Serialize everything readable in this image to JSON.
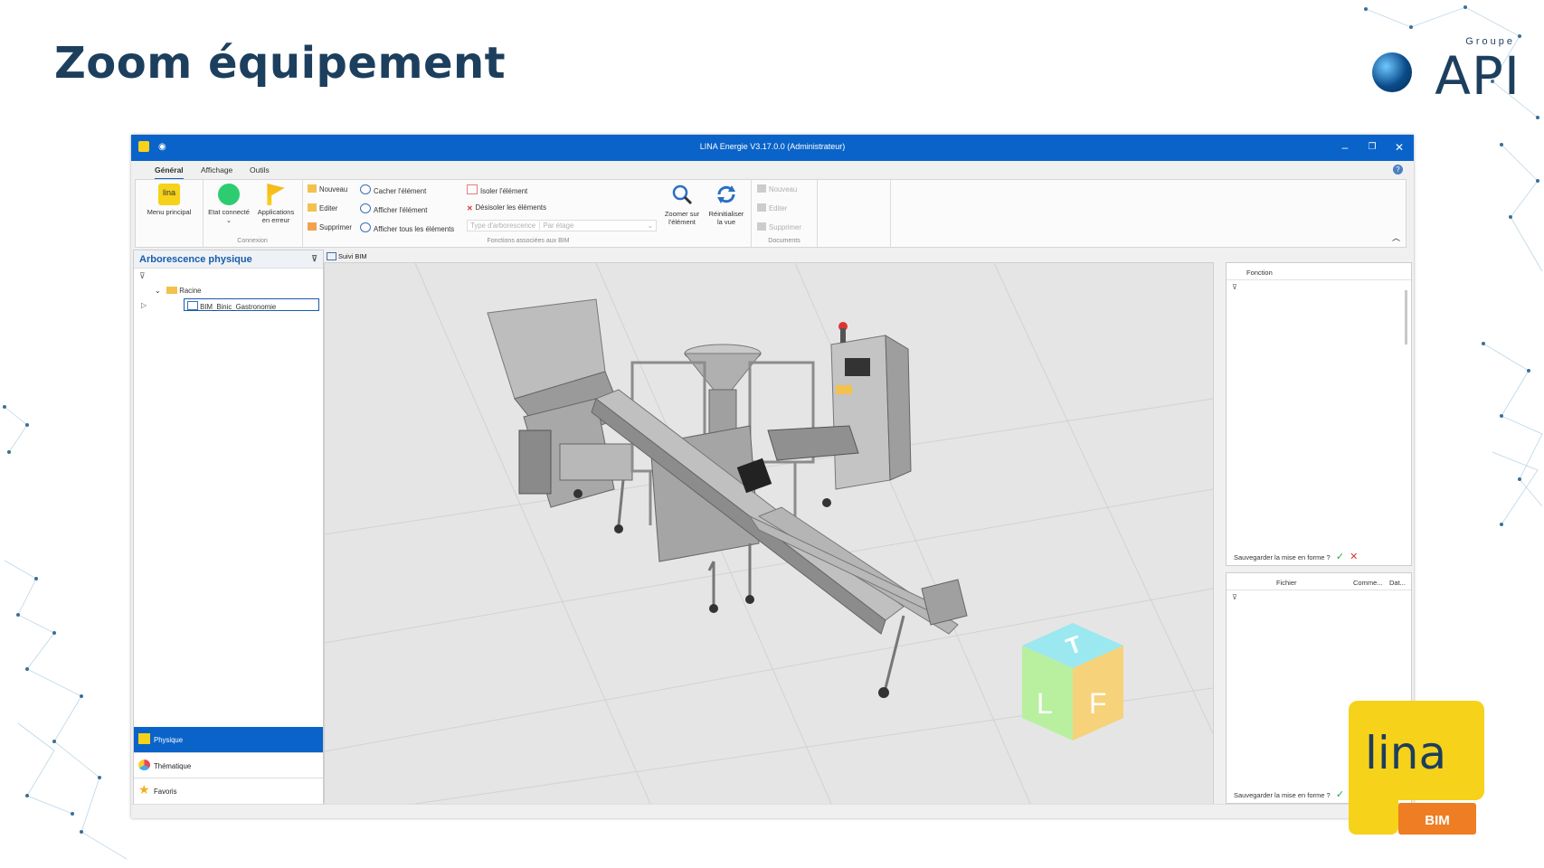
{
  "slide": {
    "title": "Zoom équipement"
  },
  "logo": {
    "groupe": "Groupe",
    "name": "API"
  },
  "app": {
    "window_title": "LINA Energie  V3.17.0.0  (Administrateur)",
    "tabs": [
      "Général",
      "Affichage",
      "Outils"
    ],
    "help": "?",
    "ribbon": {
      "menu_principal": "Menu principal",
      "etat_connecte": "Etat connecté",
      "applications": "Applications en erreur",
      "group_connexion": "Connexion",
      "bim": {
        "nouveau": "Nouveau",
        "editer": "Editer",
        "supprimer": "Supprimer",
        "cacher": "Cacher l'élément",
        "afficher": "Afficher l'élément",
        "afficher_tous": "Afficher tous les éléments",
        "isoler": "Isoler l'élément",
        "desisoler": "Désisoler les éléments",
        "type_label": "Type d'arborescence",
        "type_value": "Par étage",
        "zoomer": "Zoomer sur l'élément",
        "reinit": "Réinitialiser la vue",
        "group_label": "Fonctions associées aux BIM"
      },
      "documents": {
        "nouveau": "Nouveau",
        "editer": "Editer",
        "supprimer": "Supprimer",
        "group_label": "Documents"
      }
    },
    "left_panel": {
      "title": "Arborescence physique",
      "root": "Racine",
      "child": "BIM_Binic_Gastronomie",
      "nav": [
        "Physique",
        "Thématique",
        "Favoris"
      ]
    },
    "viewer": {
      "tab": "Suivi BIM",
      "cube_letters": [
        "T",
        "L",
        "F"
      ]
    },
    "right_panel_top": {
      "column": "Fonction",
      "save_prompt": "Sauvegarder la mise en forme ?"
    },
    "right_panel_bottom": {
      "columns": [
        "Fichier",
        "Comme...",
        "Dat..."
      ],
      "save_prompt": "Sauvegarder la mise en forme ?"
    }
  },
  "lina_badge": {
    "name": "lina",
    "sub": "BIM"
  },
  "colors": {
    "title_blue": "#1d3f5e",
    "window_blue": "#0a63c9",
    "lina_yellow": "#f6d21a",
    "lina_orange": "#ee7d23"
  }
}
